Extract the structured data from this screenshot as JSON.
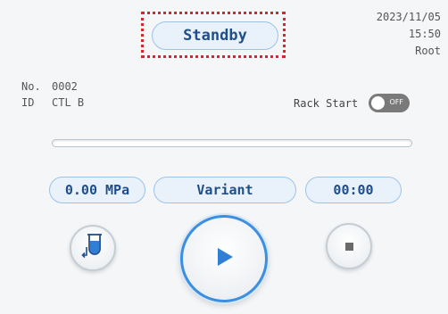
{
  "status": {
    "label": "Standby"
  },
  "meta": {
    "date": "2023/11/05",
    "time": "15:50",
    "user": "Root"
  },
  "sample": {
    "no_label": "No.",
    "no_value": "0002",
    "id_label": "ID",
    "id_value": "CTL B"
  },
  "rack": {
    "label": "Rack Start",
    "toggle_text": "OFF",
    "toggle_on": false
  },
  "progress": {
    "value": 0
  },
  "pressure": {
    "value": "0.00 MPa"
  },
  "method": {
    "value": "Variant"
  },
  "timer": {
    "value": "00:00"
  },
  "icons": {
    "sample": "sample-tube-icon",
    "play": "play-icon",
    "stop": "stop-icon"
  },
  "colors": {
    "accent": "#3b8ee0",
    "pill_text": "#1f4e8c",
    "highlight": "#d7262b"
  }
}
